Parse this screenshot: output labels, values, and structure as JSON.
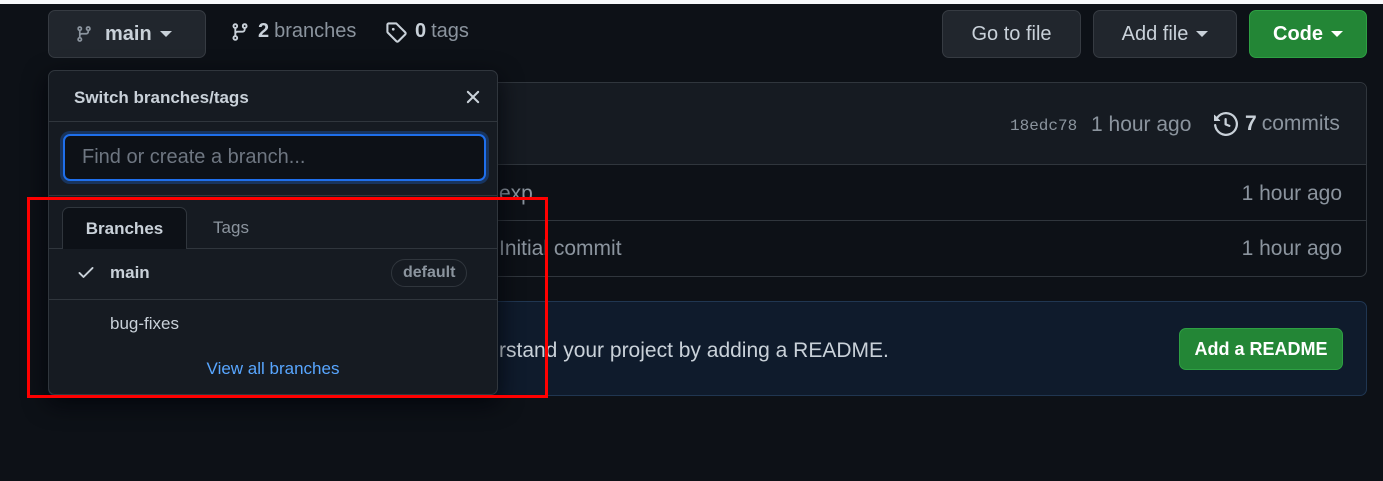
{
  "colors": {
    "background": "#0d1117",
    "accent_green": "#238636",
    "link_blue": "#58a6ff",
    "highlight_red": "#ff0000"
  },
  "toolbar": {
    "branch_button": {
      "label": "main",
      "icon": "git-branch-icon"
    },
    "branches_link": {
      "count": "2",
      "label": "branches",
      "icon": "git-branch-icon"
    },
    "tags_link": {
      "count": "0",
      "label": "tags",
      "icon": "tag-icon"
    },
    "go_to_file": "Go to file",
    "add_file": "Add file",
    "code": "Code"
  },
  "commit_header": {
    "sha": "18edc78",
    "time": "1 hour ago",
    "commits_count": "7",
    "commits_label": "commits",
    "commits_icon": "history-icon"
  },
  "files": [
    {
      "message": "exp",
      "time": "1 hour ago"
    },
    {
      "message": "Initial commit",
      "time": "1 hour ago"
    }
  ],
  "readme_banner": {
    "text": "rstand your project by adding a README.",
    "button": "Add a README"
  },
  "branch_dropdown": {
    "title": "Switch branches/tags",
    "close_icon": "close-icon",
    "search_placeholder": "Find or create a branch...",
    "tabs": [
      {
        "label": "Branches",
        "active": true
      },
      {
        "label": "Tags",
        "active": false
      }
    ],
    "branches": [
      {
        "name": "main",
        "selected": true,
        "badge": "default"
      },
      {
        "name": "bug-fixes",
        "selected": false,
        "badge": ""
      }
    ],
    "view_all": "View all branches"
  }
}
